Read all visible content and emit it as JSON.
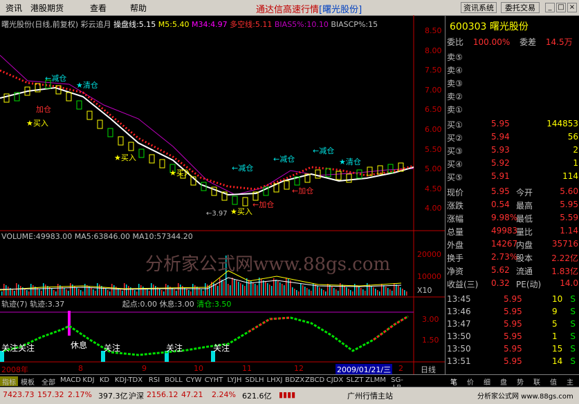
{
  "menu": {
    "items": [
      "资讯",
      "港股期货",
      "查看",
      "帮助"
    ],
    "title": "通达信高速行情",
    "title_stock": "[曙光股份]",
    "right_buttons": [
      "资讯系统",
      "委托交易"
    ]
  },
  "chart": {
    "info_main": {
      "name": "曙光股份(日线,前复权)",
      "indicator": "彩云追月",
      "k": "操盘线:5.15",
      "m5": "M5:5.40",
      "m34": "M34:4.97",
      "duo": "多空线:5.11",
      "bias": "BIAS5%:10.10",
      "biascp": "BIASCP%:15"
    },
    "price_axis": [
      "8.50",
      "8.00",
      "7.50",
      "7.00",
      "6.50",
      "6.00",
      "5.50",
      "5.00",
      "4.50",
      "4.00"
    ],
    "labels": {
      "jiancang": "减仓",
      "qingcang": "清仓",
      "mairu": "买入",
      "jiacang": "加仓",
      "low": "←3.97"
    },
    "info_vol": {
      "vol": "VOLUME:49983.00",
      "ma5": "MA5:63846.00",
      "ma10": "MA10:57344.20"
    },
    "vol_axis": [
      "20000",
      "10000",
      "X10"
    ],
    "watermark": "分析家公式网www.88gs.com",
    "info_track": {
      "name": "轨迹(7)",
      "track": "轨迹:3.37",
      "start": "起点:0.00",
      "rest": "休息:3.00",
      "clear": "清仓:3.50"
    },
    "track_axis": [
      "3.00",
      "1.50"
    ],
    "track_labels": {
      "guanzhu": "关注",
      "xiuxi": "休息"
    },
    "date_axis": [
      "2008年",
      "8",
      "9",
      "10",
      "11",
      "12",
      "2009/01/21/三",
      "2"
    ]
  },
  "quote": {
    "code": "600303",
    "name": "曙光股份",
    "wb": "委比",
    "wb_val": "100.00%",
    "wc": "委差",
    "wc_val": "14.5万",
    "sells": [
      "卖⑤",
      "卖④",
      "卖③",
      "卖②",
      "卖①"
    ],
    "buys": [
      {
        "label": "买①",
        "price": "5.95",
        "vol": "144853"
      },
      {
        "label": "买②",
        "price": "5.94",
        "vol": "56"
      },
      {
        "label": "买③",
        "price": "5.93",
        "vol": "2"
      },
      {
        "label": "买④",
        "price": "5.92",
        "vol": "1"
      },
      {
        "label": "买⑤",
        "price": "5.91",
        "vol": "114"
      }
    ],
    "stats": [
      {
        "l1": "现价",
        "v1": "5.95",
        "l2": "今开",
        "v2": "5.60"
      },
      {
        "l1": "涨跌",
        "v1": "0.54",
        "l2": "最高",
        "v2": "5.95"
      },
      {
        "l1": "涨幅",
        "v1": "9.98%",
        "l2": "最低",
        "v2": "5.59"
      },
      {
        "l1": "总量",
        "v1": "49983",
        "l2": "量比",
        "v2": "1.14"
      },
      {
        "l1": "外盘",
        "v1": "14267",
        "l2": "内盘",
        "v2": "35716"
      },
      {
        "l1": "换手",
        "v1": "2.73%",
        "l2": "股本",
        "v2": "2.22亿"
      },
      {
        "l1": "净资",
        "v1": "5.62",
        "l2": "流通",
        "v2": "1.83亿"
      },
      {
        "l1": "收益(三)",
        "v1": "0.32",
        "l2": "PE(动)",
        "v2": "14.0"
      }
    ],
    "ticks": [
      {
        "t": "13:45",
        "p": "5.95",
        "v": "10",
        "s": "S"
      },
      {
        "t": "13:46",
        "p": "5.95",
        "v": "9",
        "s": "S"
      },
      {
        "t": "13:47",
        "p": "5.95",
        "v": "5",
        "s": "S"
      },
      {
        "t": "13:50",
        "p": "5.95",
        "v": "1",
        "s": "S"
      },
      {
        "t": "13:50",
        "p": "5.95",
        "v": "15",
        "s": "S"
      },
      {
        "t": "13:51",
        "p": "5.95",
        "v": "14",
        "s": "S"
      }
    ],
    "period": "日线"
  },
  "tabs": [
    "指标",
    "模板",
    "全部",
    "MACD",
    "KDJ",
    "KD",
    "KDJ-TDX",
    "RSI",
    "BOLL",
    "CYW",
    "CYHT",
    "LYJH",
    "SDLH",
    "LHXJ",
    "BDZX",
    "ZBCD",
    "CJDX",
    "SLZT",
    "ZLMM",
    "SG-LB"
  ],
  "right_tabs": [
    "笔",
    "价",
    "细",
    "盘",
    "势",
    "联",
    "值",
    "主"
  ],
  "status": {
    "sh": "7423.73",
    "sh_chg": "157.32",
    "sh_pct": "2.17%",
    "sh_amt": "397.3亿",
    "hs_label": "沪深",
    "hs": "2156.12",
    "hs_chg": "47.21",
    "hs_pct": "2.24%",
    "hs_amt": "621.6亿",
    "station": "广州行情主站",
    "site": "分析家公式网 www.88gs.com"
  },
  "colors": {
    "up": "#ff3030",
    "down": "#00e0e0",
    "yellow": "#ffff00",
    "label": "#c0c0c0"
  }
}
